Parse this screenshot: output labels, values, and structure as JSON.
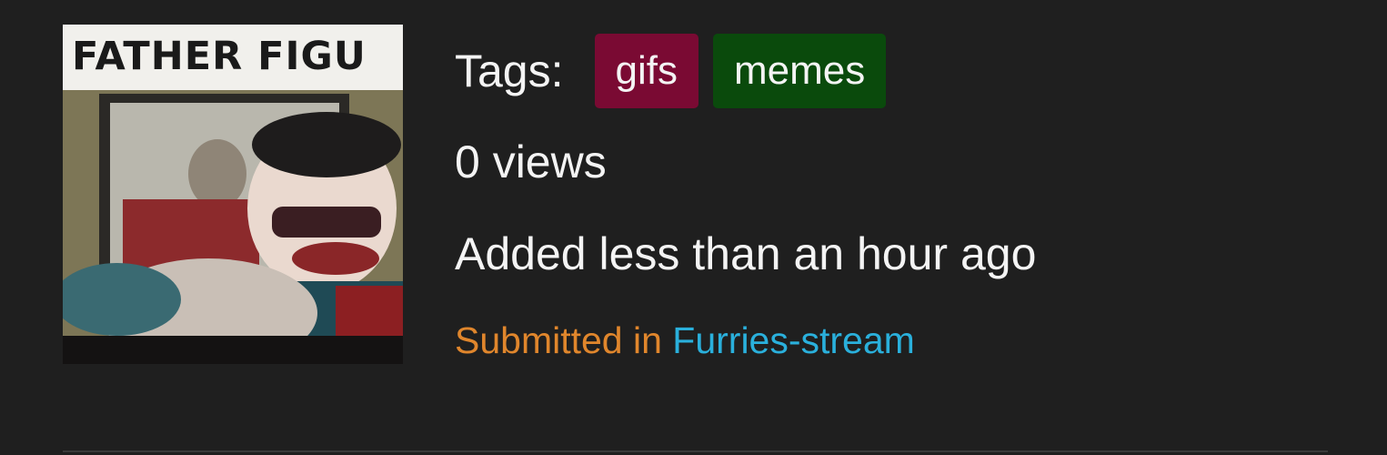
{
  "thumbnail": {
    "caption": "FATHER FIGU"
  },
  "tags": {
    "label": "Tags:",
    "items": [
      {
        "label": "gifs",
        "color": "#7a0a33"
      },
      {
        "label": "memes",
        "color": "#0a4a0c"
      }
    ]
  },
  "stats": {
    "views": "0 views",
    "added": "Added less than an hour ago"
  },
  "submission": {
    "prefix": "Submitted in ",
    "stream": "Furries-stream"
  },
  "colors": {
    "background": "#1f1f1f",
    "text": "#f4f4f4",
    "submitted_prefix": "#e0862c",
    "stream_link": "#2ab0dc"
  }
}
